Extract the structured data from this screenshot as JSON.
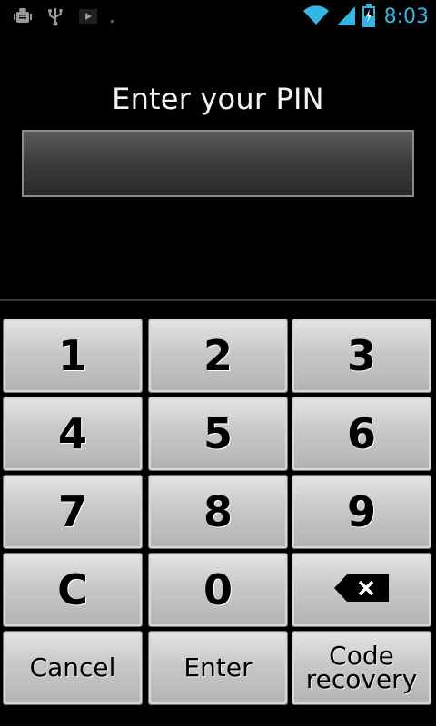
{
  "status_bar": {
    "time": "8:03",
    "accent_color": "#33b5e5",
    "left_icons": [
      "android-debug-icon",
      "usb-icon",
      "play-store-icon"
    ],
    "right_icons": [
      "wifi-icon",
      "signal-icon",
      "battery-charging-icon"
    ]
  },
  "screen": {
    "title": "Enter your PIN",
    "pin_value": ""
  },
  "keypad": {
    "k1": "1",
    "k2": "2",
    "k3": "3",
    "k4": "4",
    "k5": "5",
    "k6": "6",
    "k7": "7",
    "k8": "8",
    "k9": "9",
    "clear": "C",
    "k0": "0",
    "backspace_icon": "backspace-icon",
    "cancel": "Cancel",
    "enter": "Enter",
    "code_recovery_line1": "Code",
    "code_recovery_line2": "recovery"
  }
}
